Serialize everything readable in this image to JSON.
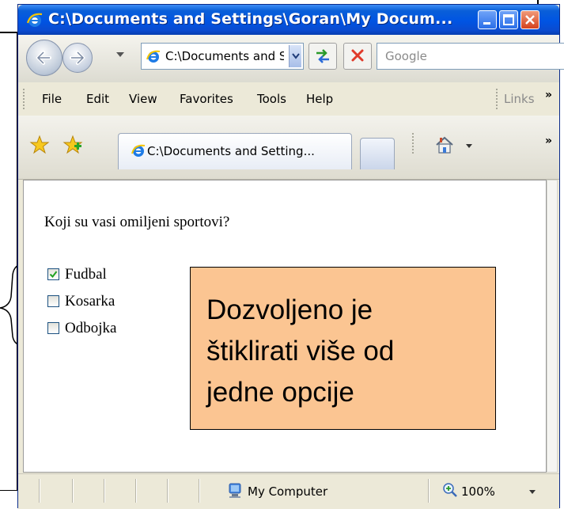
{
  "window": {
    "title": "C:\\Documents and Settings\\Goran\\My Docum..."
  },
  "navbar": {
    "address": "C:\\Documents and Sett",
    "search_placeholder": "Google"
  },
  "menu": {
    "items": [
      "File",
      "Edit",
      "View",
      "Favorites",
      "Tools",
      "Help"
    ],
    "links_label": "Links",
    "overflow": "»"
  },
  "tabs": {
    "active_tab_label": "C:\\Documents and Setting..."
  },
  "content": {
    "question": "Koji su vasi omiljeni sportovi?",
    "options": [
      {
        "label": "Fudbal",
        "checked": true
      },
      {
        "label": "Kosarka",
        "checked": false
      },
      {
        "label": "Odbojka",
        "checked": false
      }
    ]
  },
  "callout": {
    "lines": [
      "Dozvoljeno je",
      "štiklirati više od",
      "jedne opcije"
    ],
    "color": "#fbc592"
  },
  "status": {
    "zone": "My Computer",
    "zoom": "100%"
  },
  "colors": {
    "titlebar": "#0054e3",
    "chrome": "#ece9d8",
    "checkbox_border": "#1c5180",
    "check_mark": "#21a121"
  }
}
